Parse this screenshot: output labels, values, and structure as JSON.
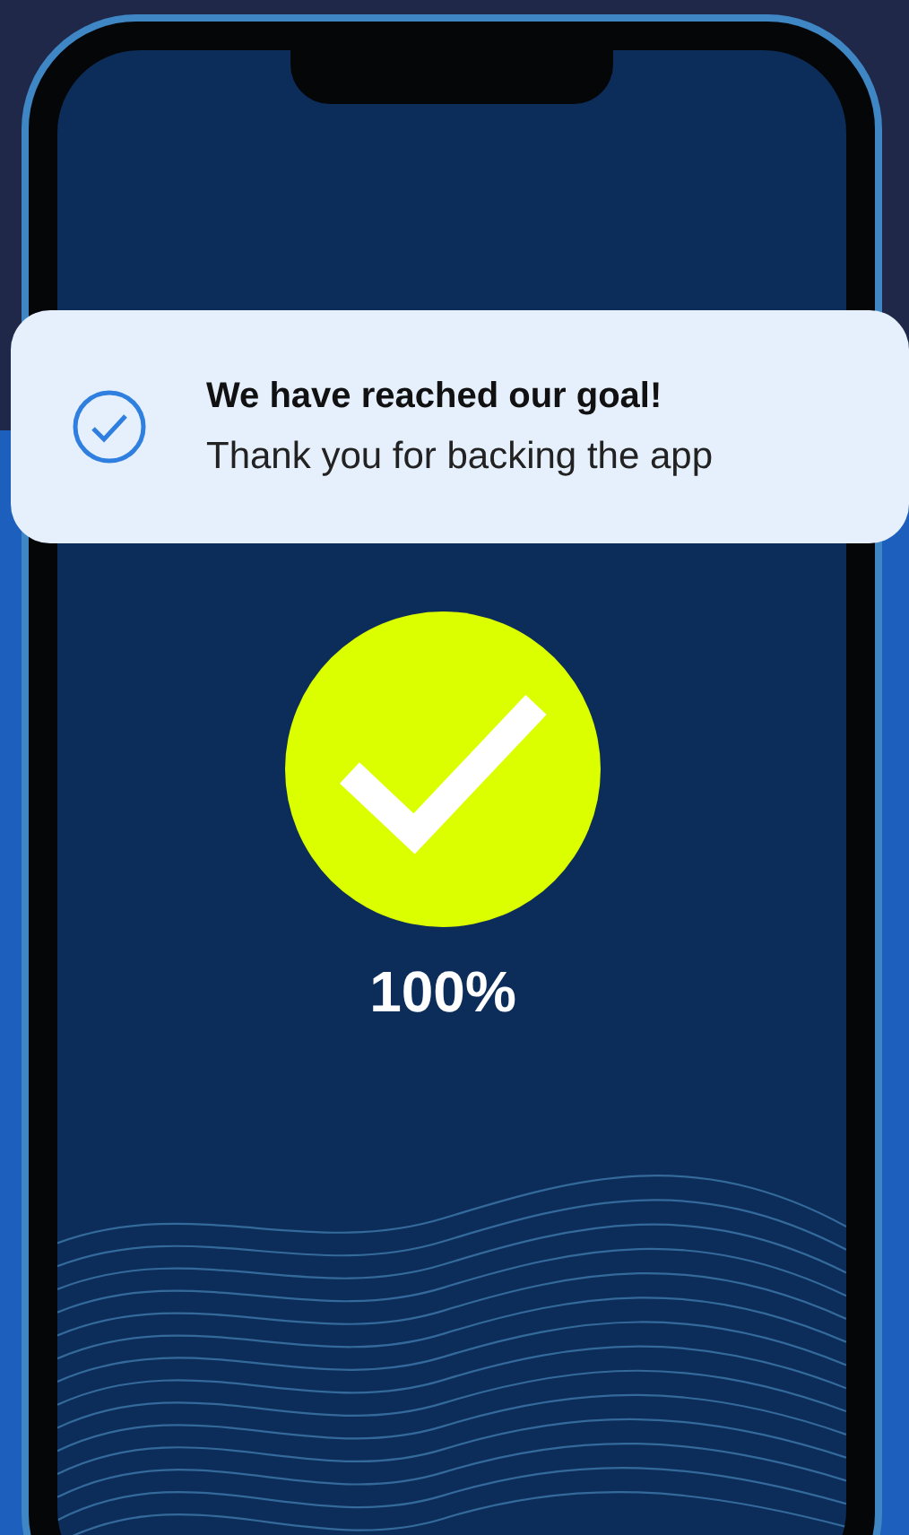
{
  "notification": {
    "title": "We have reached our goal!",
    "message": "Thank you for backing the app"
  },
  "progress": {
    "label": "100%"
  }
}
